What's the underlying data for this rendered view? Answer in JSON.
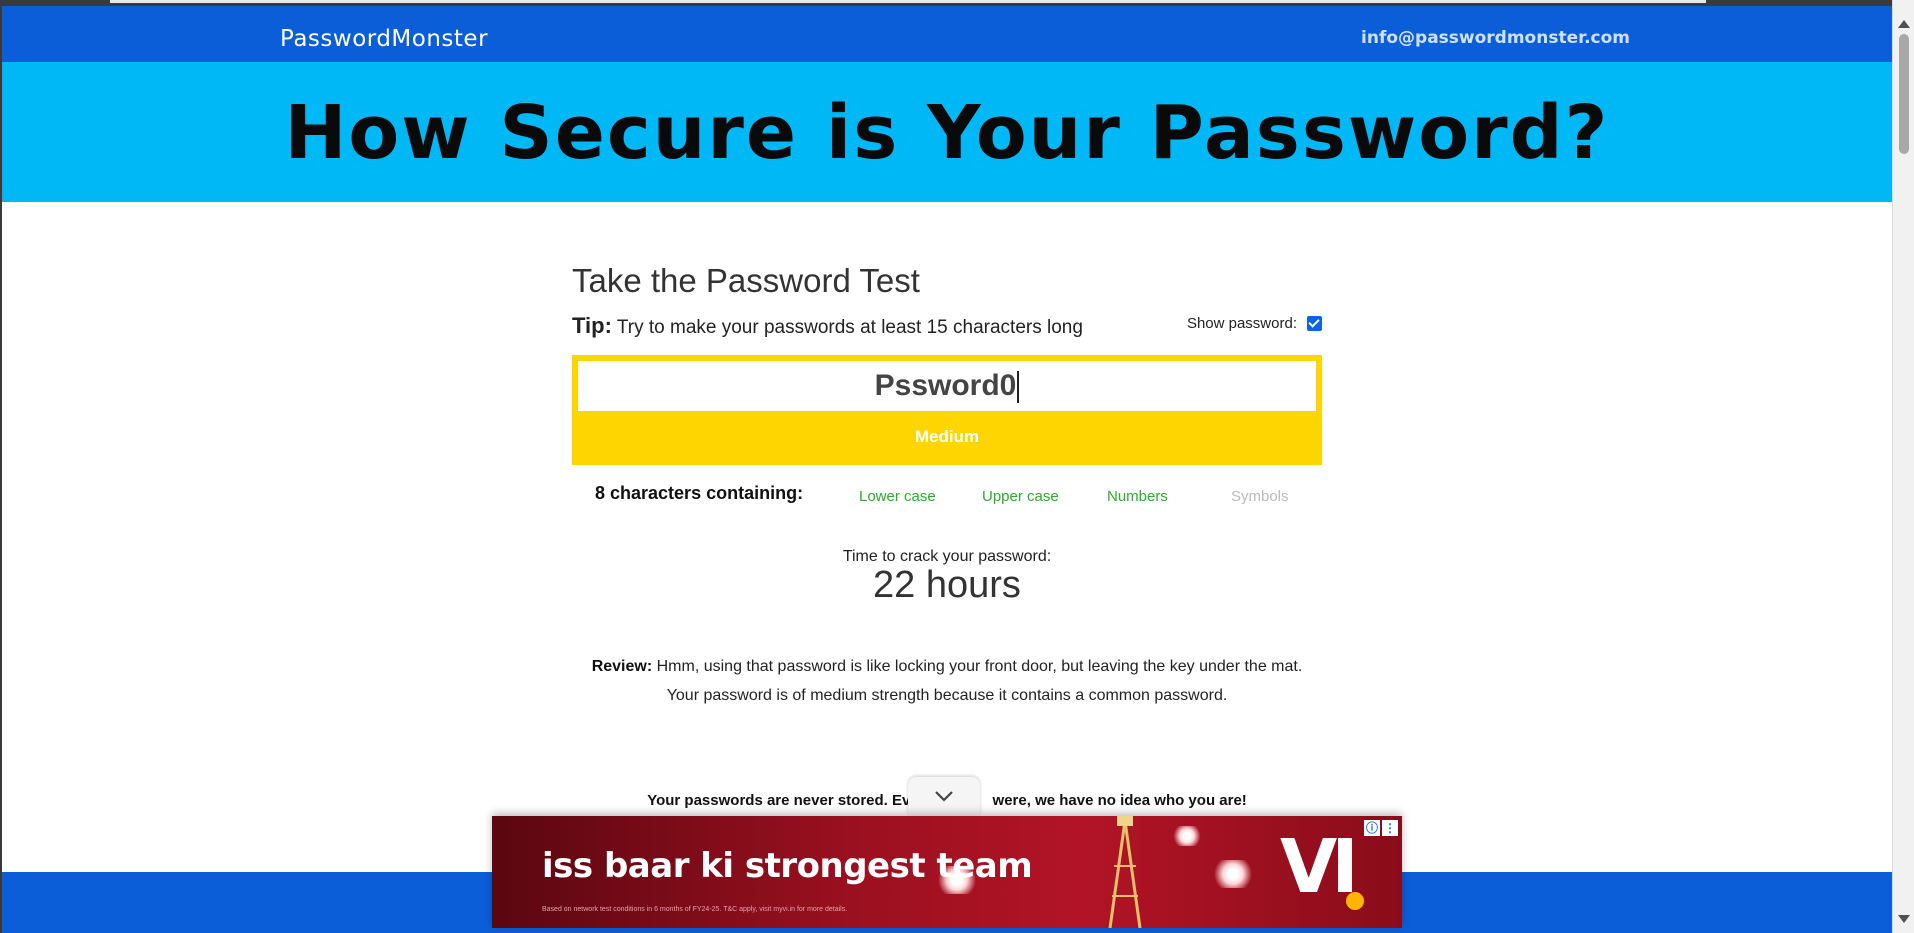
{
  "header": {
    "brand": "PasswordMonster",
    "email": "info@passwordmonster.com"
  },
  "hero": {
    "title": "How Secure is Your Password?"
  },
  "test": {
    "title": "Take the Password Test",
    "tip_label": "Tip:",
    "tip_text": " Try to make your passwords at least 15 characters long",
    "show_password_label": "Show password:",
    "show_password_checked": true,
    "password_value": "Pssword0",
    "strength_label": "Medium",
    "strength_color": "#ffd500"
  },
  "characters": {
    "count_label": "8 characters containing:",
    "types": [
      {
        "label": "Lower case",
        "present": true
      },
      {
        "label": "Upper case",
        "present": true
      },
      {
        "label": "Numbers",
        "present": true
      },
      {
        "label": "Symbols",
        "present": false
      }
    ]
  },
  "crack": {
    "label": "Time to crack your password:",
    "value": "22 hours"
  },
  "review": {
    "label": "Review:",
    "text": " Hmm, using that password is like locking your front door, but leaving the key under the mat.",
    "detail": "Your password is of medium strength because it contains a common password."
  },
  "privacy": {
    "text_before": "Your passwords are never stored. Ev",
    "text_after": " were, we have no idea who you are!"
  },
  "ad": {
    "headline": "iss baar ki strongest team",
    "fine_print": "Based on network test conditions in 6 months of FY24-25. T&C apply, visit myvi.in for more details.",
    "logo": "VI"
  },
  "colors": {
    "topbar": "#0b5ed7",
    "hero": "#00b8f5",
    "present": "#2eaa2e",
    "absent": "#bbbbbb"
  }
}
